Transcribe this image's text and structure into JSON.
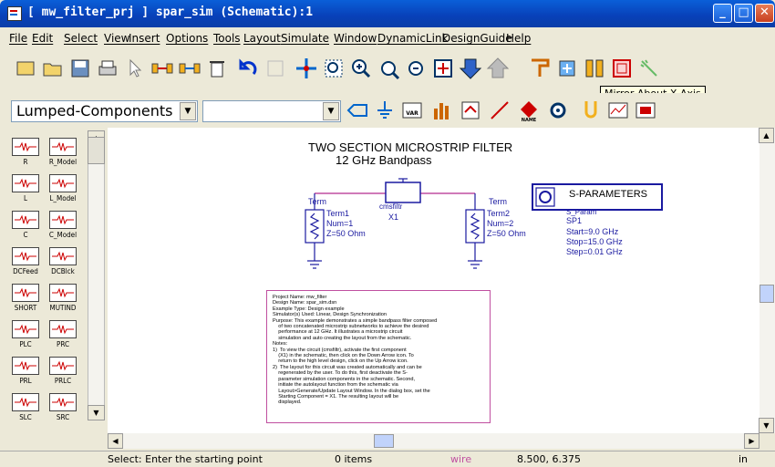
{
  "window": {
    "title": "[ mw_filter_prj ] spar_sim (Schematic):1",
    "controls": {
      "minimize": "_",
      "maximize": "□",
      "close": "✕"
    }
  },
  "menu": [
    "File",
    "Edit",
    "Select",
    "View",
    "Insert",
    "Options",
    "Tools",
    "Layout",
    "Simulate",
    "Window",
    "DynamicLink",
    "DesignGuide",
    "Help"
  ],
  "toolbar": {
    "tooltip": "Mirror About X Axis",
    "buttons": [
      "new-icon",
      "open-icon",
      "save-icon",
      "print-icon",
      "select-pointer-icon",
      "insert-wire-icon",
      "insert-pin-icon",
      "delete-icon",
      "undo-icon",
      "redo-icon",
      "move-icon",
      "zoom-area-icon",
      "zoom-in-icon",
      "zoom-out-icon",
      "zoom-full-icon",
      "fit-icon",
      "push-into-icon",
      "pop-out-icon",
      "wire-tool-icon",
      "rotate-icon",
      "mirror-y-icon",
      "mirror-x-icon",
      "highlight-icon"
    ]
  },
  "palette_toolbar": {
    "library": "Lumped-Components",
    "component": "",
    "buttons": [
      "port-icon",
      "ground-icon",
      "var-icon",
      "simulate-icon",
      "tune-icon",
      "wire-icon",
      "name-icon",
      "settings-icon",
      "probe-icon",
      "display-icon",
      "data-display-icon"
    ],
    "var_label": "VAR",
    "name_label": "NAME"
  },
  "palette": {
    "items": [
      {
        "label": "R"
      },
      {
        "label": "R_Model"
      },
      {
        "label": "L"
      },
      {
        "label": "L_Model"
      },
      {
        "label": "C"
      },
      {
        "label": "C_Model"
      },
      {
        "label": "DCFeed"
      },
      {
        "label": "DCBlck"
      },
      {
        "label": "SHORT"
      },
      {
        "label": "MUTIND"
      },
      {
        "label": "PLC"
      },
      {
        "label": "PRC"
      },
      {
        "label": "PRL"
      },
      {
        "label": "PRLC"
      },
      {
        "label": "SLC"
      },
      {
        "label": "SRC"
      }
    ]
  },
  "schematic": {
    "title": "TWO SECTION MICROSTRIP FILTER",
    "subtitle": "12 GHz Bandpass",
    "term1": {
      "type": "Term",
      "name": "Term1",
      "num": "Num=1",
      "z": "Z=50 Ohm"
    },
    "term2": {
      "type": "Term",
      "name": "Term2",
      "num": "Num=2",
      "z": "Z=50 Ohm"
    },
    "subckt": {
      "type": "cmsfiltr",
      "name": "X1"
    },
    "sparam": {
      "header": "S-PARAMETERS",
      "type": "S_Param",
      "name": "SP1",
      "start": "Start=9.0 GHz",
      "stop": "Stop=15.0 GHz",
      "step": "Step=0.01 GHz"
    },
    "notes": [
      "Project Name: mw_filter",
      "Design Name: spar_sim.dsn",
      "Example Type: Design example",
      "Simulator(s) Used: Linear, Design Synchronization",
      "Purpose: This example demonstrates a simple bandpass filter composed",
      "    of two concatenated microstrip subnetworks to achieve the desired",
      "    performance at 12 GHz. It illustrates a microstrip circuit",
      "    simulation and auto creating the layout from the schematic.",
      "Notes:",
      "1)  To view the circuit (cmsfiltr), activate the first component",
      "    (X1) in the schematic, then click on the Down Arrow icon. To",
      "    return to the high level design, click on the Up Arrow icon.",
      "2)  The layout for this circuit was created automatically and can be",
      "    regenerated by the user. To do this, first deactivate the S-",
      "    parameter simulation components in the schematic. Second,",
      "    initiate the autolayout function from the schematic via",
      "    Layout>Generate/Update Layout Window. In the dialog box, set the",
      "    Starting Component = X1. The resulting layout will be",
      "    displayed."
    ]
  },
  "status": {
    "prompt": "Select: Enter the starting point",
    "items": "0 items",
    "mode": "wire",
    "coords": "8.500, 6.375",
    "units": "in"
  },
  "colors": {
    "wire": "#c04fa0",
    "component": "#1a1aa0",
    "sparam_border": "#1a1aa0",
    "mode_text": "#c04fa0"
  }
}
